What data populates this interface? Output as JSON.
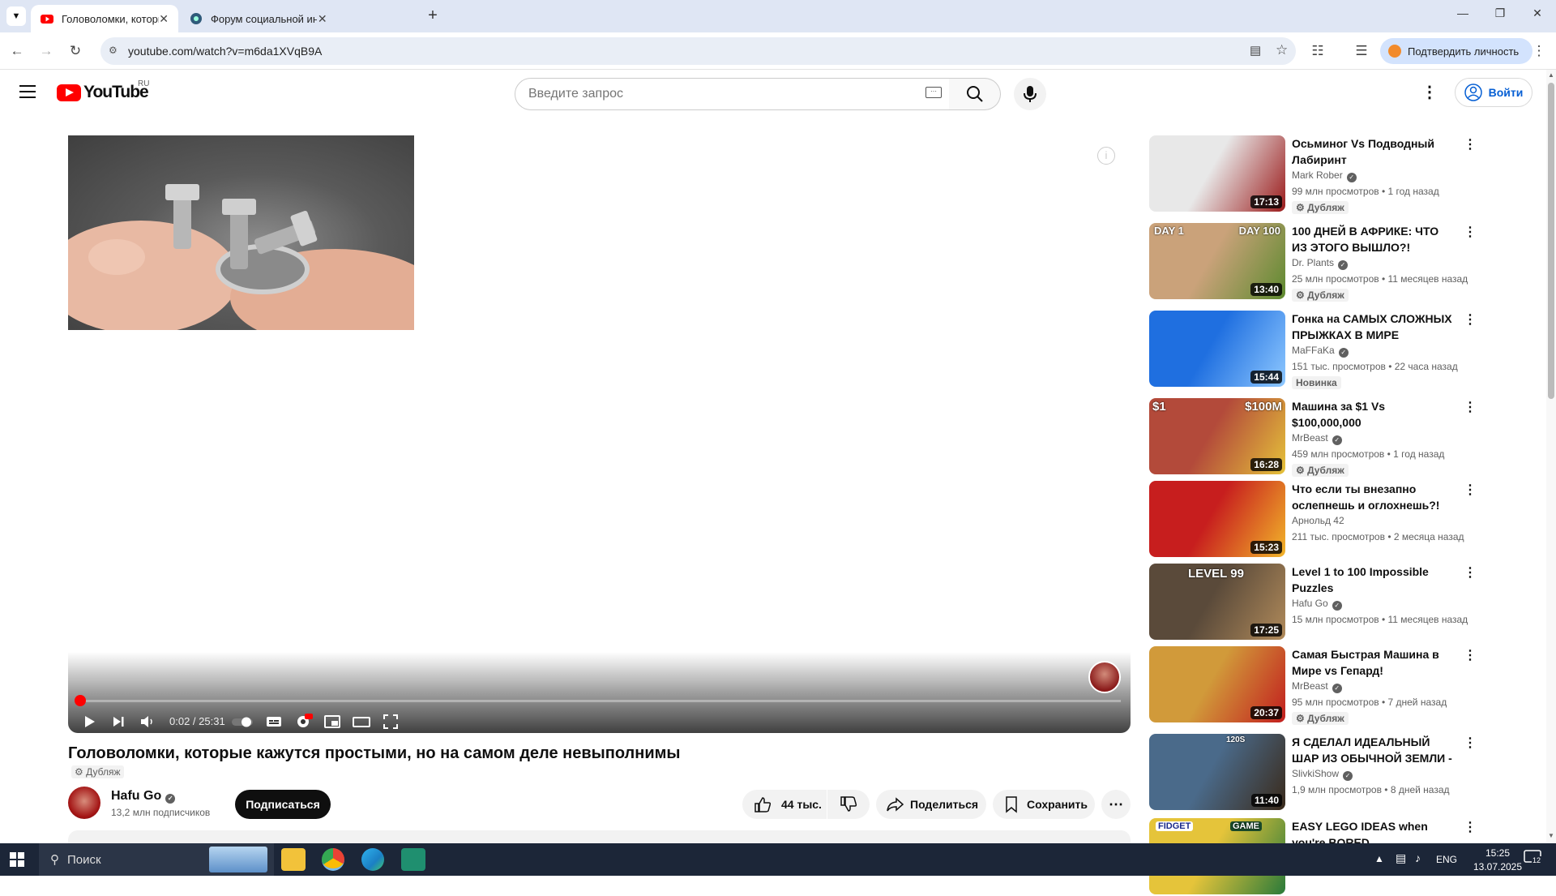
{
  "browser": {
    "tabs": [
      {
        "title": "Головоломки, которые кажутс",
        "active": true,
        "icon": "youtube-icon"
      },
      {
        "title": "Форум социальной инженери",
        "active": false,
        "icon": "forum-icon"
      }
    ],
    "url": "youtube.com/watch?v=m6da1XVqB9A",
    "verify_label": "Подтвердить личность"
  },
  "header": {
    "logo_text": "YouTube",
    "region": "RU",
    "search_placeholder": "Введите запрос",
    "signin_label": "Войти"
  },
  "player": {
    "time": "0:02 / 25:31",
    "progress_fraction": 0.0013
  },
  "video": {
    "title": "Головоломки, которые кажутся простыми, но на самом деле невыполнимы",
    "dub_label": "Дубляж",
    "channel": "Hafu Go",
    "subscribers": "13,2 млн подписчиков",
    "subscribe_label": "Подписаться",
    "likes": "44 тыс.",
    "share_label": "Поделиться",
    "save_label": "Сохранить"
  },
  "recommendations": [
    {
      "title": "Осьминог Vs Подводный Лабиринт",
      "channel": "Mark Rober",
      "verified": true,
      "views": "99 млн просмотров",
      "age": "1 год назад",
      "duration": "17:13",
      "badge": "Дубляж",
      "color_a": "#e8e8e8",
      "color_b": "#9b1b1b"
    },
    {
      "title": "100 ДНЕЙ В АФРИКЕ: ЧТО ИЗ ЭТОГО ВЫШЛО?!",
      "channel": "Dr. Plants",
      "verified": true,
      "views": "25 млн просмотров",
      "age": "11 месяцев назад",
      "duration": "13:40",
      "badge": "Дубляж",
      "color_a": "#caa27a",
      "color_b": "#5d8a2f"
    },
    {
      "title": "Гонка на САМЫХ СЛОЖНЫХ ПРЫЖКАХ В МИРЕ",
      "channel": "MaFFaKa",
      "verified": true,
      "views": "151 тыс. просмотров",
      "age": "22 часа назад",
      "duration": "15:44",
      "badge": "Новинка",
      "color_a": "#1f6fe0",
      "color_b": "#8ec8ff"
    },
    {
      "title": "Машина за $1 Vs $100,000,000",
      "channel": "MrBeast",
      "verified": true,
      "views": "459 млн просмотров",
      "age": "1 год назад",
      "duration": "16:28",
      "badge": "Дубляж",
      "color_a": "#b34a3a",
      "color_b": "#e5c23a"
    },
    {
      "title": "Что если ты внезапно ослепнешь и оглохнешь?!",
      "channel": "Арнольд 42",
      "verified": false,
      "views": "211 тыс. просмотров",
      "age": "2 месяца назад",
      "duration": "15:23",
      "badge": "",
      "color_a": "#c71e1e",
      "color_b": "#f2b52a"
    },
    {
      "title": "Level 1 to 100 Impossible Puzzles",
      "channel": "Hafu Go",
      "verified": true,
      "views": "15 млн просмотров",
      "age": "11 месяцев назад",
      "duration": "17:25",
      "badge": "",
      "color_a": "#5a4a3a",
      "color_b": "#b08a5a"
    },
    {
      "title": "Самая Быстрая Машина в Мире vs Гепард!",
      "channel": "MrBeast",
      "verified": true,
      "views": "95 млн просмотров",
      "age": "7 дней назад",
      "duration": "20:37",
      "badge": "Дубляж",
      "color_a": "#d19a3a",
      "color_b": "#c21e1e"
    },
    {
      "title": "Я СДЕЛАЛ ИДЕАЛЬНЫЙ ШАР ИЗ ОБЫЧНОЙ ЗЕМЛИ - ...",
      "channel": "SlivkiShow",
      "verified": true,
      "views": "1,9 млн просмотров",
      "age": "8 дней назад",
      "duration": "11:40",
      "badge": "",
      "color_a": "#4a6a8a",
      "color_b": "#3a2a1a"
    },
    {
      "title": "EASY LEGO IDEAS when you're BORED",
      "channel": "",
      "verified": false,
      "views": "",
      "age": "",
      "duration": "",
      "badge": "",
      "color_a": "#e5c43a",
      "color_b": "#2a7a3a"
    }
  ],
  "rec_thumb_captions": {
    "r1a": "DAY 1",
    "r1b": "DAY 100",
    "r3a": "$1",
    "r3b": "$100M",
    "r5": "LEVEL 99",
    "r7": "120S",
    "r8a": "FIDGET",
    "r8b": "GAME"
  },
  "taskbar": {
    "search_label": "Поиск",
    "lang": "ENG",
    "time": "15:25",
    "date": "13.07.2025",
    "notif_count": "12"
  }
}
